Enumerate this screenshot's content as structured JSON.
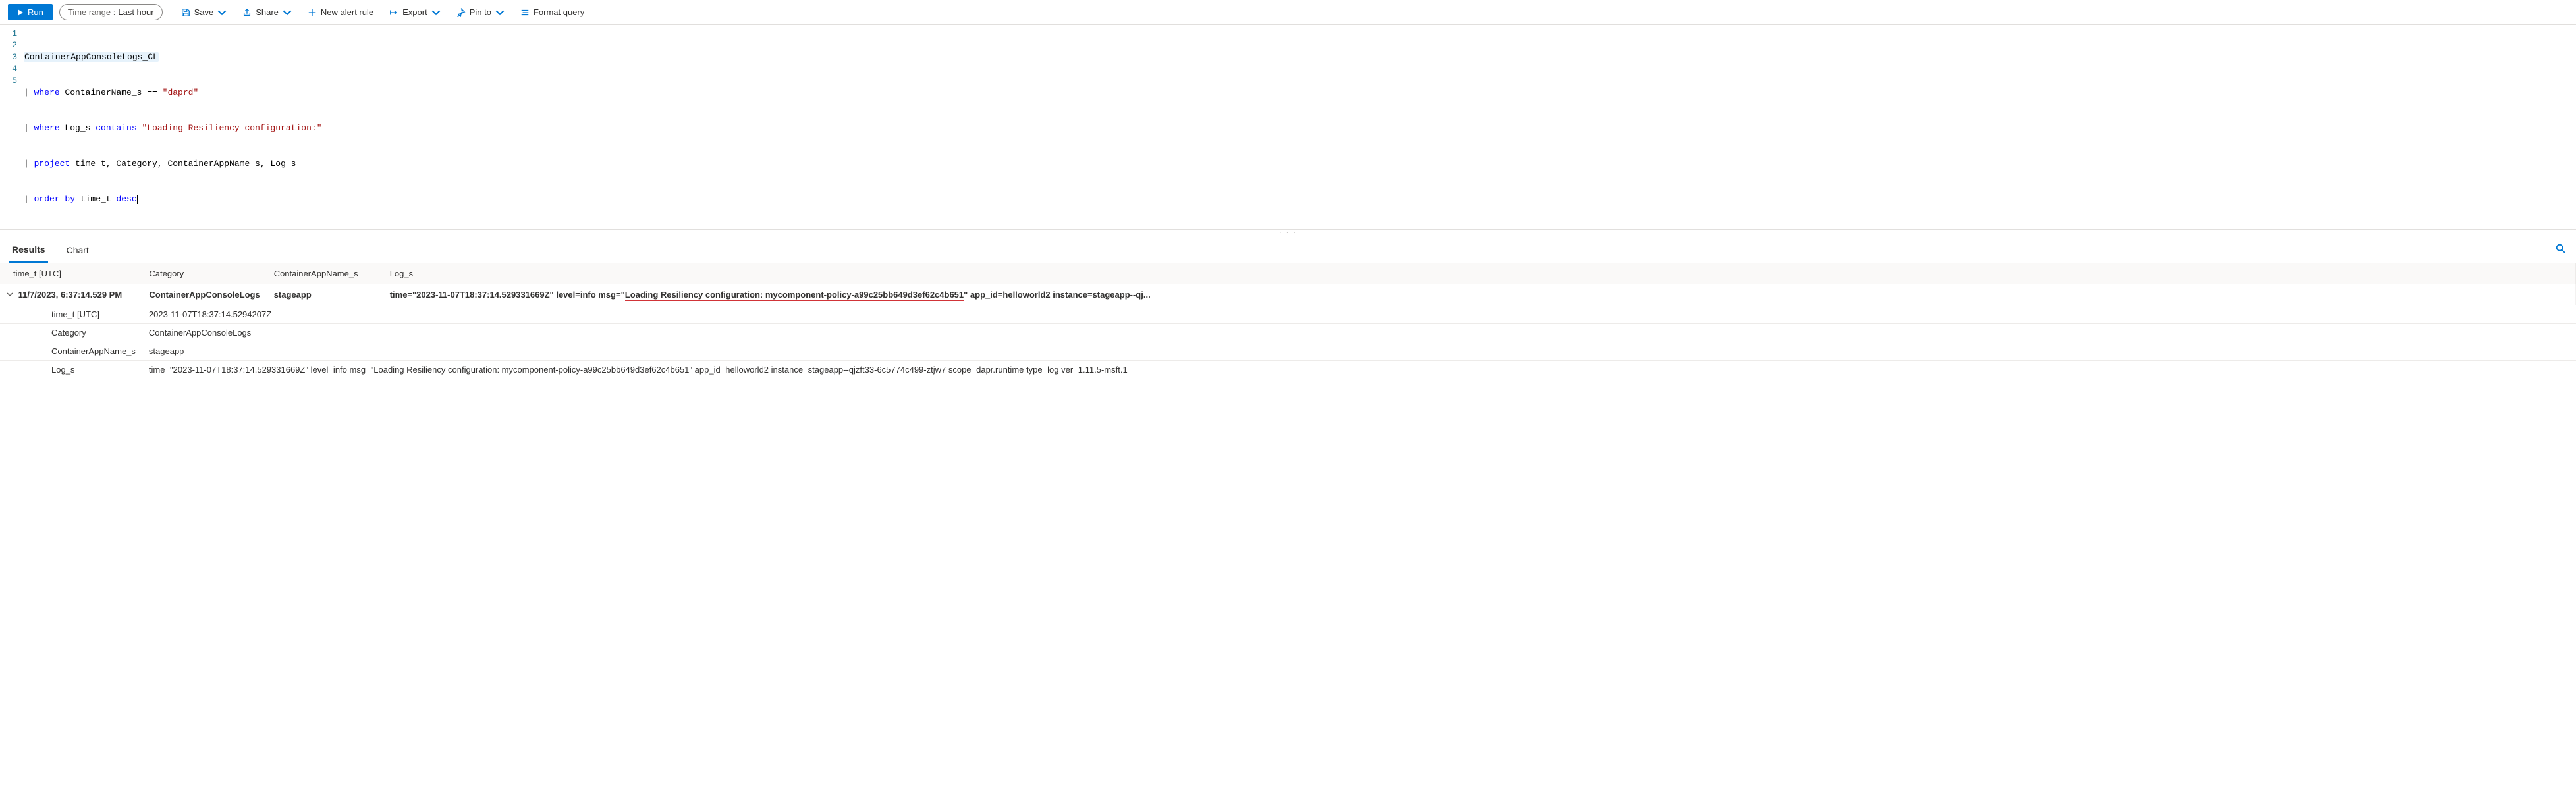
{
  "toolbar": {
    "run_label": "Run",
    "time_range_prefix": "Time range :",
    "time_range_value": "Last hour",
    "save_label": "Save",
    "share_label": "Share",
    "new_alert_label": "New alert rule",
    "export_label": "Export",
    "pin_label": "Pin to",
    "format_label": "Format query"
  },
  "editor": {
    "lines": {
      "l1": "ContainerAppConsoleLogs_CL",
      "l2_kw1": "where",
      "l2_rest": " ContainerName_s == ",
      "l2_str": "\"daprd\"",
      "l3_kw1": "where",
      "l3_rest": " Log_s ",
      "l3_kw2": "contains",
      "l3_sp": " ",
      "l3_str": "\"Loading Resiliency configuration:\"",
      "l4_kw1": "project",
      "l4_rest": " time_t, Category, ContainerAppName_s, Log_s",
      "l5_kw1": "order by",
      "l5_rest": " time_t ",
      "l5_kw2": "desc"
    },
    "line_numbers": [
      "1",
      "2",
      "3",
      "4",
      "5"
    ]
  },
  "tabs": {
    "results": "Results",
    "chart": "Chart"
  },
  "table": {
    "headers": {
      "c1": "time_t [UTC]",
      "c2": "Category",
      "c3": "ContainerAppName_s",
      "c4": "Log_s"
    },
    "row": {
      "time_display": "11/7/2023, 6:37:14.529 PM",
      "category": "ContainerAppConsoleLogs",
      "app": "stageapp",
      "log_prefix": "time=\"2023-11-07T18:37:14.529331669Z\" level=info msg=\"",
      "log_highlight": "Loading Resiliency configuration: mycomponent-policy-a99c25bb649d3ef62c4b651",
      "log_suffix": "\" app_id=helloworld2 instance=stageapp--qj..."
    },
    "details": {
      "k1": "time_t [UTC]",
      "v1": "2023-11-07T18:37:14.5294207Z",
      "k2": "Category",
      "v2": "ContainerAppConsoleLogs",
      "k3": "ContainerAppName_s",
      "v3": "stageapp",
      "k4": "Log_s",
      "v4": "time=\"2023-11-07T18:37:14.529331669Z\" level=info msg=\"Loading Resiliency configuration: mycomponent-policy-a99c25bb649d3ef62c4b651\" app_id=helloworld2 instance=stageapp--qjzft33-6c5774c499-ztjw7 scope=dapr.runtime type=log ver=1.11.5-msft.1"
    }
  }
}
